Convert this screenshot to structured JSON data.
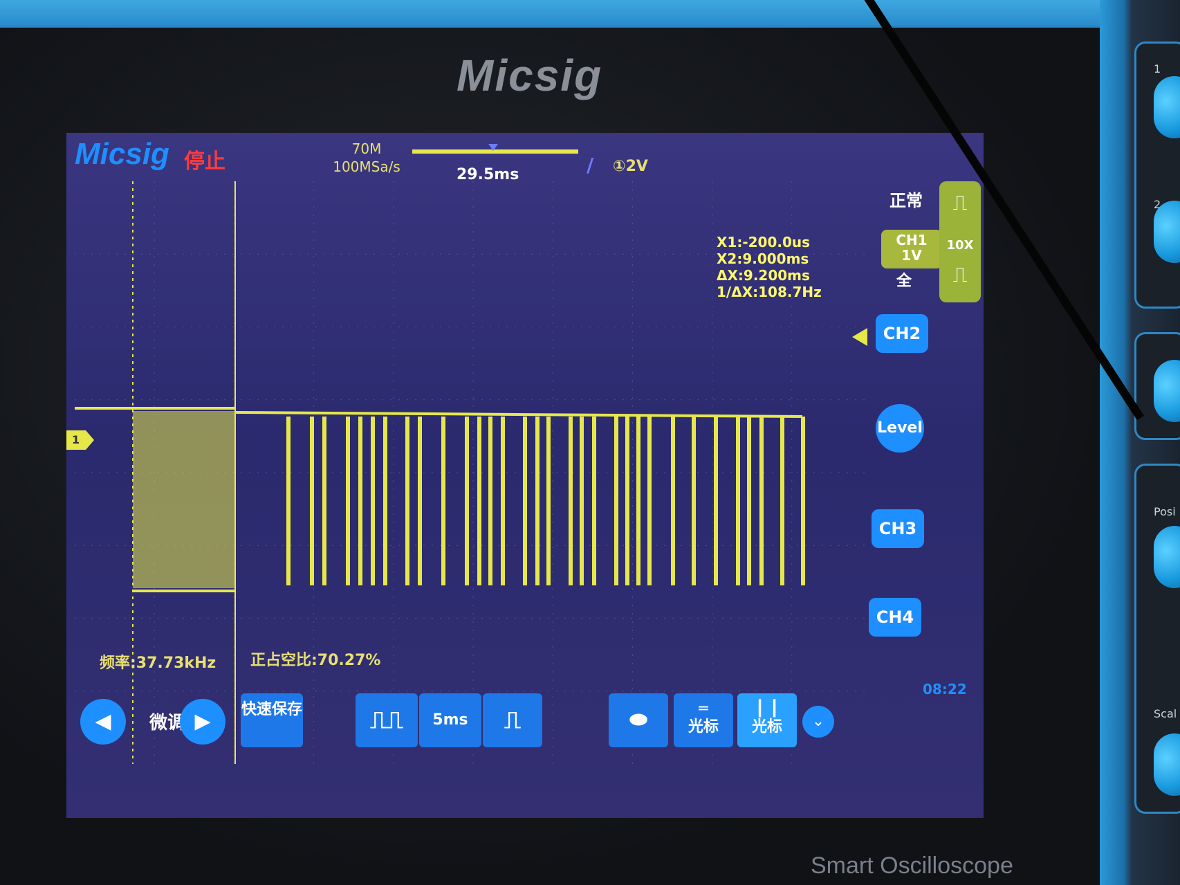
{
  "device": {
    "brand": "Micsig",
    "model_tag": "Smart Oscilloscope",
    "knob_labels": [
      "1",
      "2",
      "Posi",
      "Scal"
    ]
  },
  "topbar": {
    "logo": "Micsig",
    "run_status": "停止",
    "bandwidth": "70M",
    "sample_rate": "100MSa/s",
    "horizontal_position": "29.5ms",
    "trigger_edge": "/",
    "trigger_level": "①2V"
  },
  "right_panel": {
    "trigger_mode": "正常",
    "ch1_label": "CH1",
    "ch1_scale": "1V",
    "ch1_coupling": "全",
    "probe": "10X",
    "rising_icon": "rising-edge-icon",
    "falling_icon": "falling-edge-icon",
    "ch2": "CH2",
    "level": "Level",
    "ch3": "CH3",
    "ch4": "CH4",
    "clock": "08:22"
  },
  "cursors": {
    "x1": "X1:-200.0us",
    "x2": "X2:9.000ms",
    "dx": "ΔX:9.200ms",
    "inv_dx": "1/ΔX:108.7Hz"
  },
  "measurements": {
    "frequency": "频率:37.73kHz",
    "duty": "正占空比:70.27%"
  },
  "bottombar": {
    "fine_label": "微调",
    "quick_save": "快速保存",
    "timebase": "5ms",
    "h_cursor": "光标",
    "v_cursor": "光标"
  },
  "colors": {
    "trace": "#e6e84a",
    "accent": "#1e8fff",
    "screen_bg": "#2f2c72"
  },
  "chart_data": {
    "type": "line",
    "description_series": "CH1",
    "burst_start_ms": 0.0,
    "pulse_high_v": 1.0,
    "pulse_low_v": 0.0
  }
}
